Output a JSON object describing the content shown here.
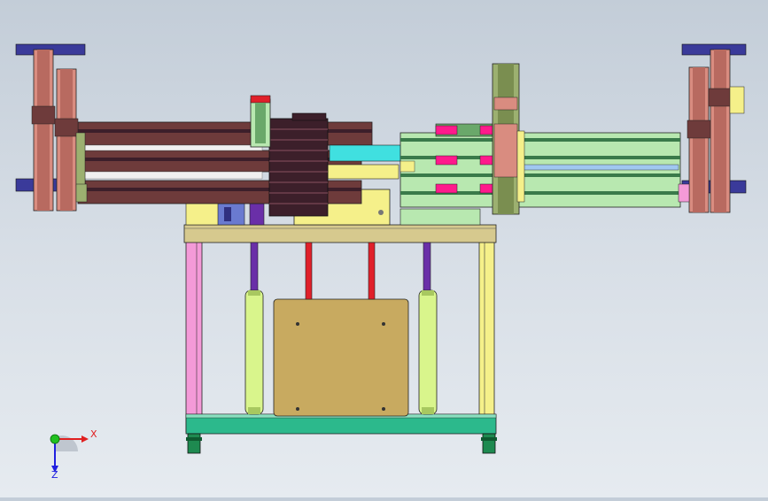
{
  "viewport": {
    "background_top": "#c3cdd8",
    "background_bottom": "#e6ebf0"
  },
  "model": {
    "colors": {
      "frame_yellow": "#f5f08a",
      "frame_pink": "#f49ad8",
      "table_top": "#d6c98e",
      "base_plate": "#2cb98c",
      "cabinet_plate": "#c8aa60",
      "gas_spring": "#d9f58c",
      "rod_purple": "#6a2fa8",
      "rod_red": "#e0202a",
      "rail_brown": "#6e3b3b",
      "rail_dark": "#3c1f2a",
      "cylinder_pink": "#d98c80",
      "column_green": "#9cb070",
      "accent_cyan": "#40e0e0",
      "accent_magenta": "#ff1a8c",
      "bracket_blue": "#3a3a9a",
      "rail_light_green": "#b8e8b0",
      "wheel_green": "#1e8a50"
    }
  },
  "triad": {
    "x_label": "X",
    "z_label": "Z",
    "x_color": "#e02020",
    "y_color": "#20c020",
    "z_color": "#2020e0"
  }
}
